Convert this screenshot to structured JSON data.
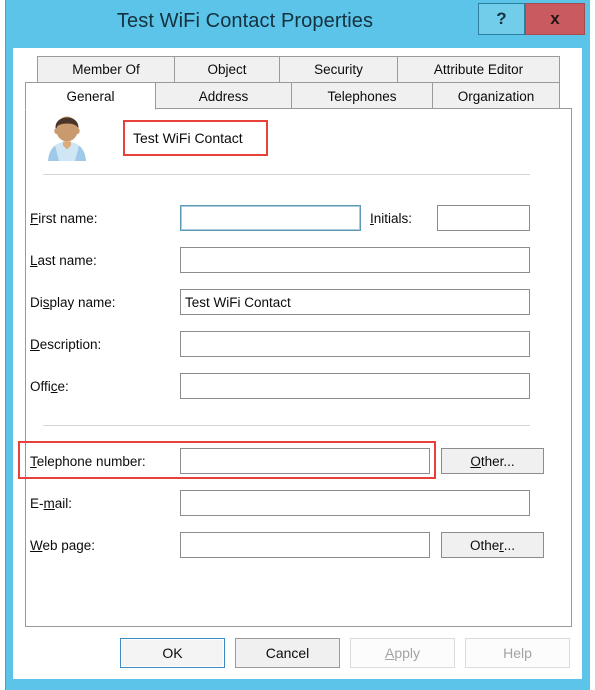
{
  "window": {
    "title": "Test WiFi Contact Properties",
    "help_button": "?",
    "close_button": "x",
    "titlebar_color": "#5cc4e8",
    "close_color": "#c95b60"
  },
  "tabs": {
    "row1": [
      {
        "label": "Member Of",
        "selected": false
      },
      {
        "label": "Object",
        "selected": false
      },
      {
        "label": "Security",
        "selected": false
      },
      {
        "label": "Attribute Editor",
        "selected": false
      }
    ],
    "row2": [
      {
        "label": "General",
        "selected": true
      },
      {
        "label": "Address",
        "selected": false
      },
      {
        "label": "Telephones",
        "selected": false
      },
      {
        "label": "Organization",
        "selected": false
      }
    ]
  },
  "header": {
    "icon": "contact-avatar-icon",
    "contact_name": "Test WiFi Contact",
    "annotation_color": "#e8403a"
  },
  "form": {
    "first_name": {
      "label_pre": "",
      "label_key": "F",
      "label_post": "irst name:",
      "value": "",
      "focused": true
    },
    "initials": {
      "label_pre": "",
      "label_key": "I",
      "label_post": "nitials:",
      "value": ""
    },
    "last_name": {
      "label_pre": "",
      "label_key": "L",
      "label_post": "ast name:",
      "value": ""
    },
    "display_name": {
      "label_pre": "Di",
      "label_key": "s",
      "label_post": "play name:",
      "value": "Test WiFi Contact"
    },
    "description": {
      "label_pre": "",
      "label_key": "D",
      "label_post": "escription:",
      "value": ""
    },
    "office": {
      "label_pre": "Offi",
      "label_key": "c",
      "label_post": "e:",
      "value": ""
    },
    "telephone_number": {
      "label_pre": "",
      "label_key": "T",
      "label_post": "elephone number:",
      "value": "",
      "annotated": true
    },
    "telephone_other": {
      "label_pre": "",
      "label_key": "O",
      "label_post": "ther..."
    },
    "email": {
      "label_pre": "E-",
      "label_key": "m",
      "label_post": "ail:",
      "value": ""
    },
    "web_page": {
      "label_pre": "",
      "label_key": "W",
      "label_post": "eb page:",
      "value": ""
    },
    "web_other": {
      "label_pre": "Othe",
      "label_key": "r",
      "label_post": "..."
    }
  },
  "footer": {
    "ok": "OK",
    "cancel": "Cancel",
    "apply_pre": "",
    "apply_key": "A",
    "apply_post": "pply",
    "help": "Help"
  }
}
